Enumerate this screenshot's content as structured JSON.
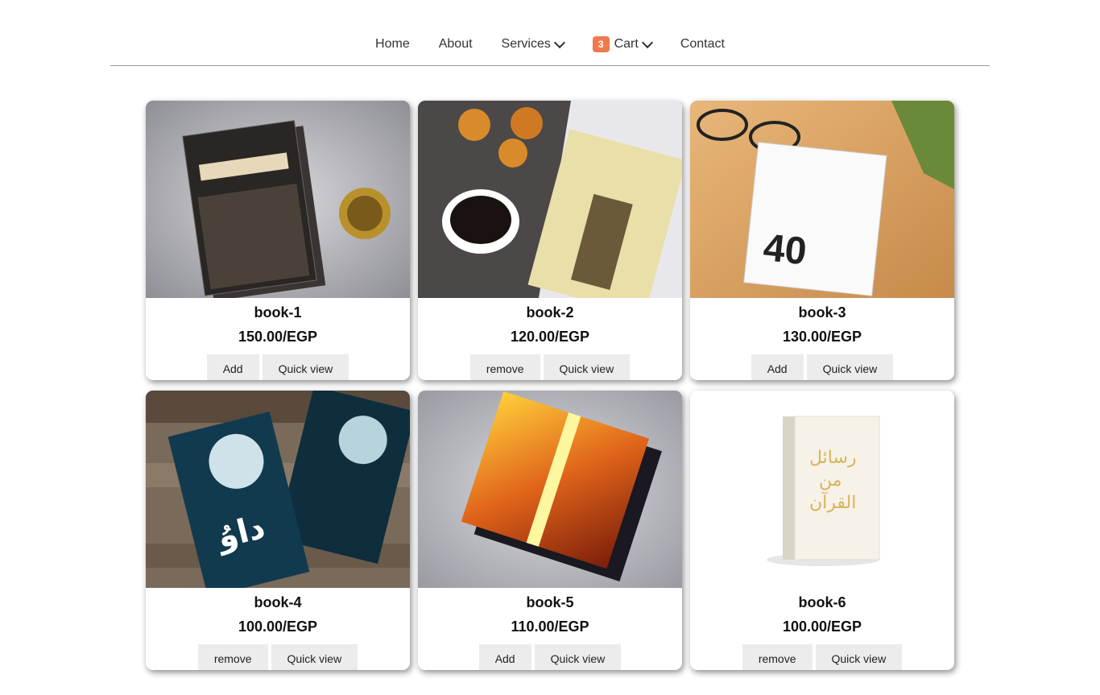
{
  "nav": {
    "items": [
      {
        "label": "Home"
      },
      {
        "label": "About"
      },
      {
        "label": "Services"
      },
      {
        "label": "Cart",
        "badge": "3"
      },
      {
        "label": "Contact"
      }
    ]
  },
  "products": [
    {
      "name": "book-1",
      "price": "150.00/EGP",
      "action": "Add",
      "quick": "Quick view"
    },
    {
      "name": "book-2",
      "price": "120.00/EGP",
      "action": "remove",
      "quick": "Quick view"
    },
    {
      "name": "book-3",
      "price": "130.00/EGP",
      "action": "Add",
      "quick": "Quick view"
    },
    {
      "name": "book-4",
      "price": "100.00/EGP",
      "action": "remove",
      "quick": "Quick view"
    },
    {
      "name": "book-5",
      "price": "110.00/EGP",
      "action": "Add",
      "quick": "Quick view"
    },
    {
      "name": "book-6",
      "price": "100.00/EGP",
      "action": "remove",
      "quick": "Quick view"
    }
  ],
  "colors": {
    "badge": "#f07a4e",
    "button_bg": "#ececec",
    "divider": "#9a9a9a"
  }
}
